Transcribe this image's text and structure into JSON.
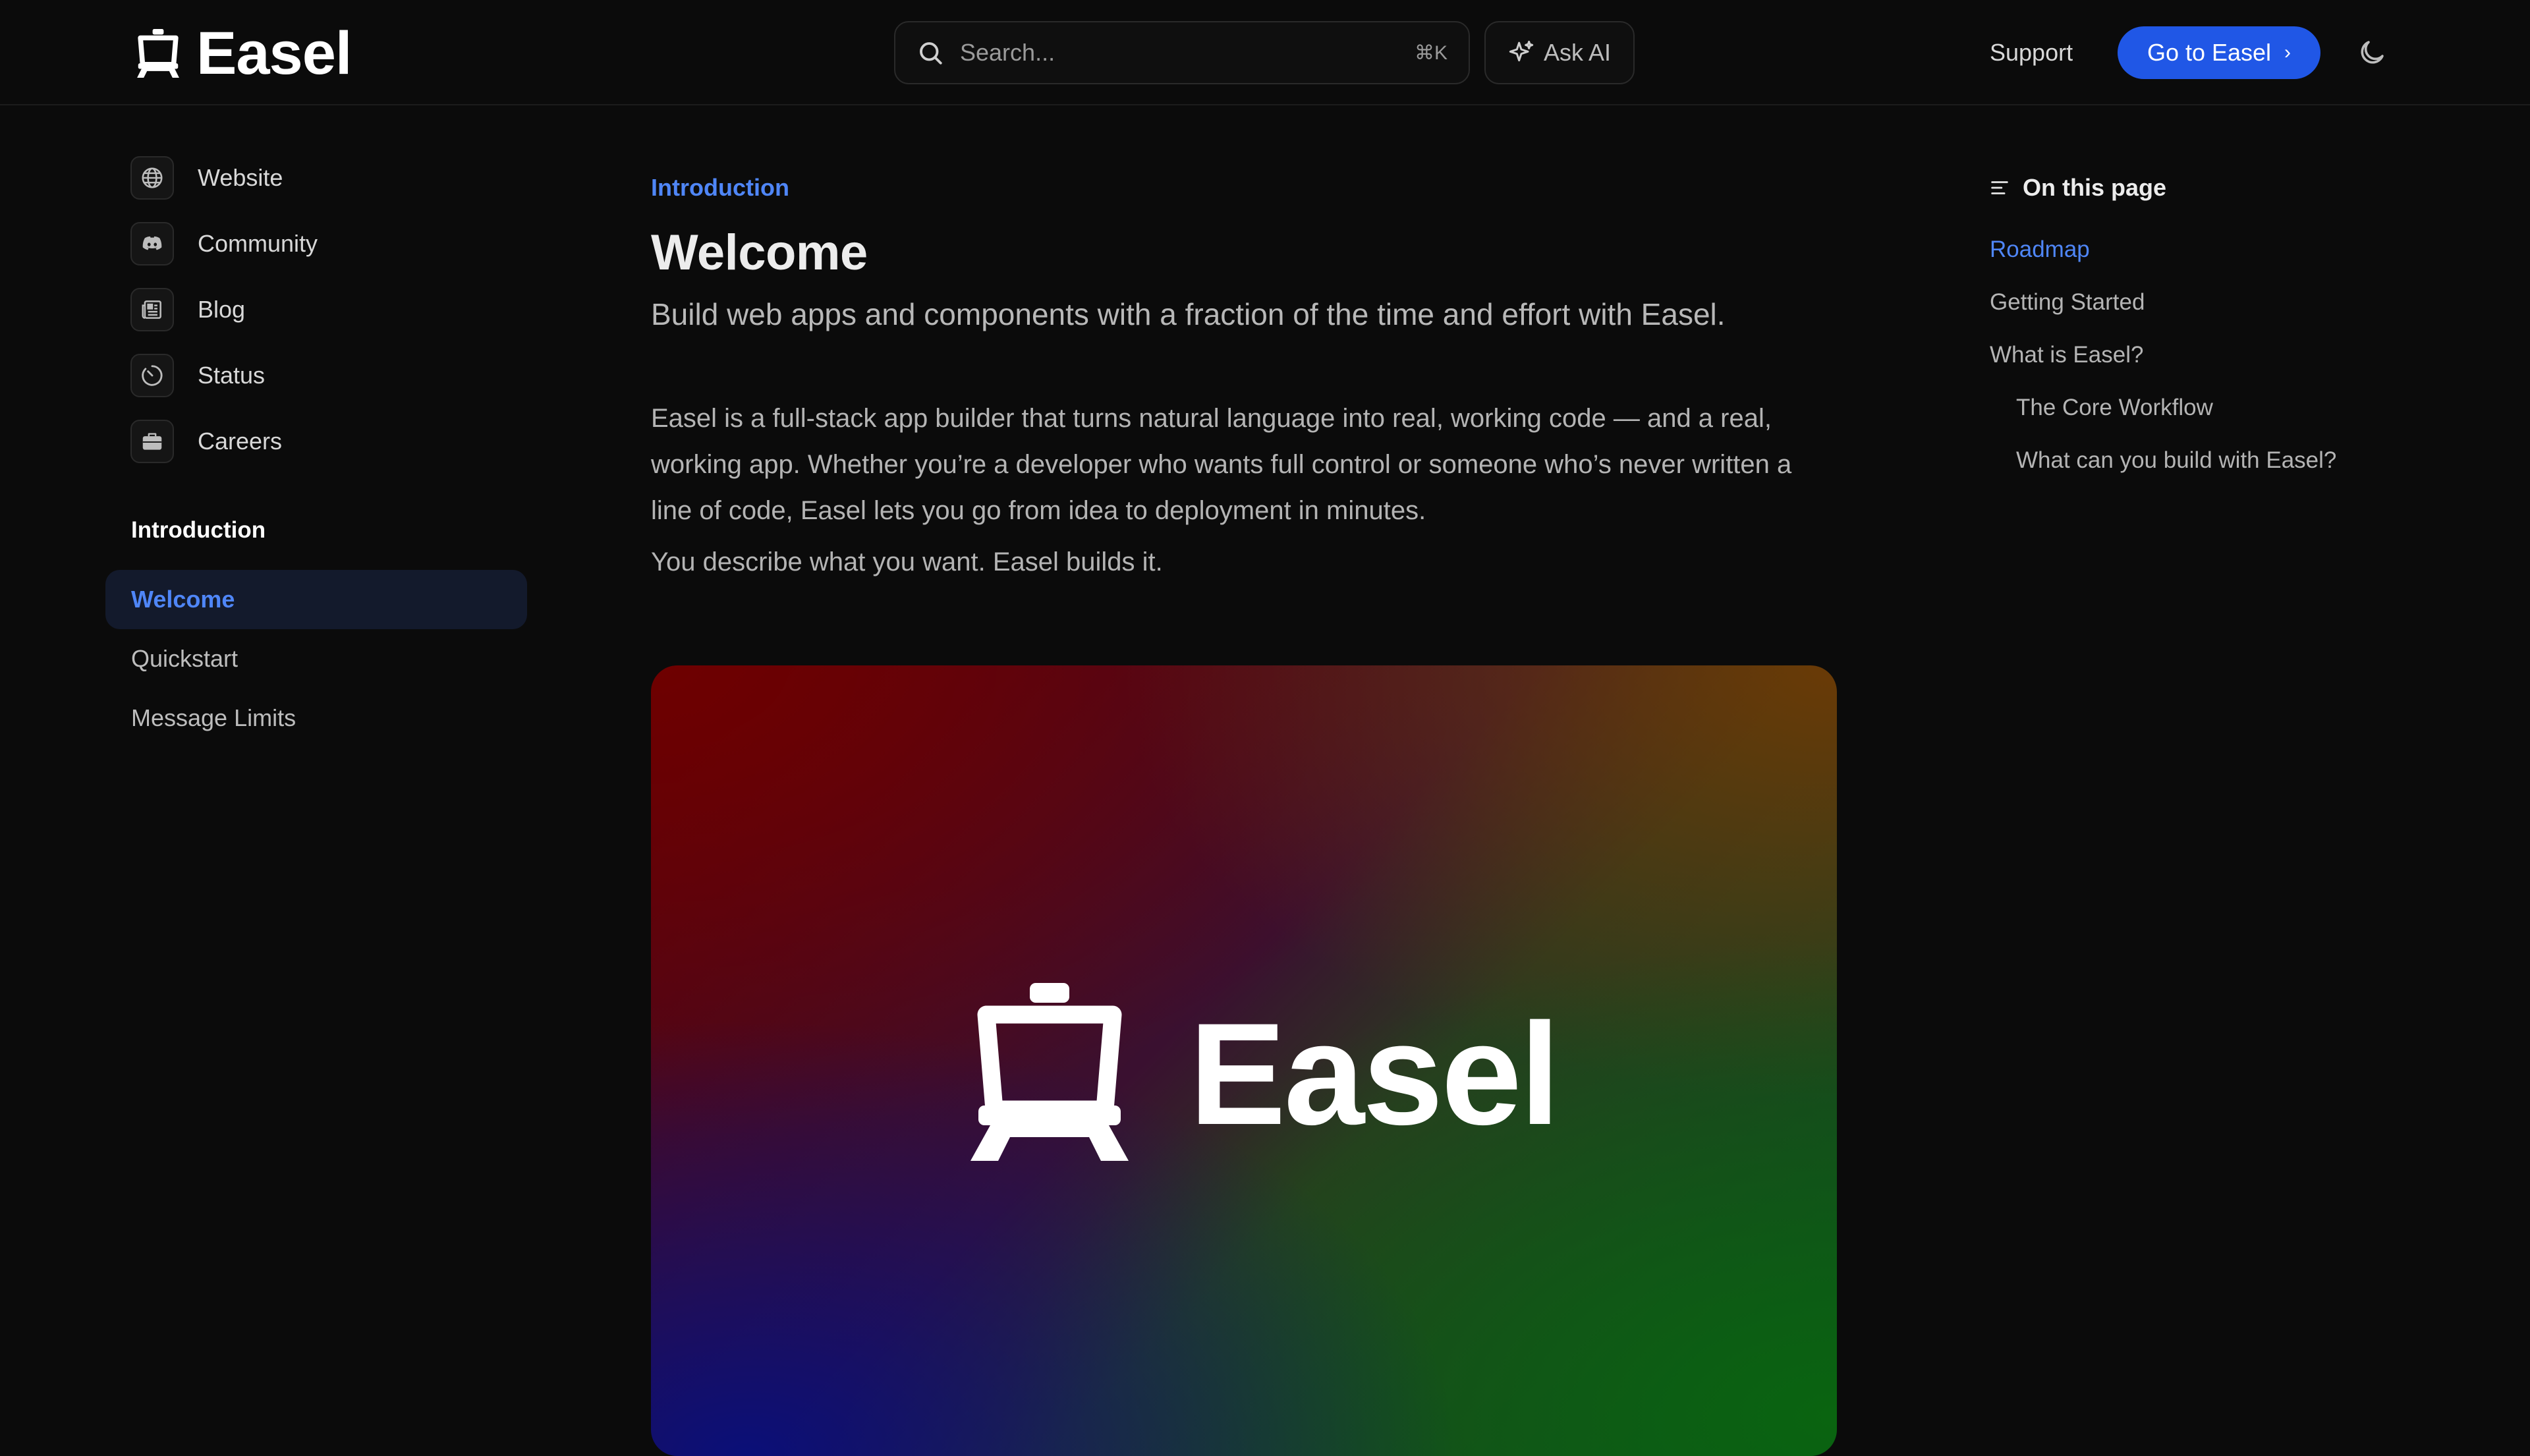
{
  "header": {
    "brand_name": "Easel",
    "search_placeholder": "Search...",
    "search_shortcut": "⌘K",
    "ask_ai_label": "Ask AI",
    "support_label": "Support",
    "cta_label": "Go to Easel",
    "cta_color": "#2057e6"
  },
  "sidebar": {
    "external_links": [
      {
        "label": "Website",
        "icon": "globe-icon"
      },
      {
        "label": "Community",
        "icon": "discord-icon"
      },
      {
        "label": "Blog",
        "icon": "newspaper-icon"
      },
      {
        "label": "Status",
        "icon": "clock-icon"
      },
      {
        "label": "Careers",
        "icon": "briefcase-icon"
      }
    ],
    "section_title": "Introduction",
    "nav_items": [
      {
        "label": "Welcome",
        "active": true
      },
      {
        "label": "Quickstart",
        "active": false
      },
      {
        "label": "Message Limits",
        "active": false
      }
    ],
    "accent_color": "#4f86f7"
  },
  "main": {
    "eyebrow": "Introduction",
    "title": "Welcome",
    "subtitle": "Build web apps and components with a fraction of the time and effort with Easel.",
    "paragraph_1": "Easel is a full-stack app builder that turns natural language into real, working code — and a real, working app. Whether you’re a developer who wants full control or someone who’s never written a line of code, Easel lets you go from idea to deployment in minutes.",
    "paragraph_2": "You describe what you want. Easel builds it.",
    "hero_brand": "Easel"
  },
  "toc": {
    "title": "On this page",
    "items": [
      {
        "label": "Roadmap",
        "active": true,
        "indent": false
      },
      {
        "label": "Getting Started",
        "active": false,
        "indent": false
      },
      {
        "label": "What is Easel?",
        "active": false,
        "indent": false
      },
      {
        "label": "The Core Workflow",
        "active": false,
        "indent": true
      },
      {
        "label": "What can you build with Easel?",
        "active": false,
        "indent": true
      }
    ]
  }
}
